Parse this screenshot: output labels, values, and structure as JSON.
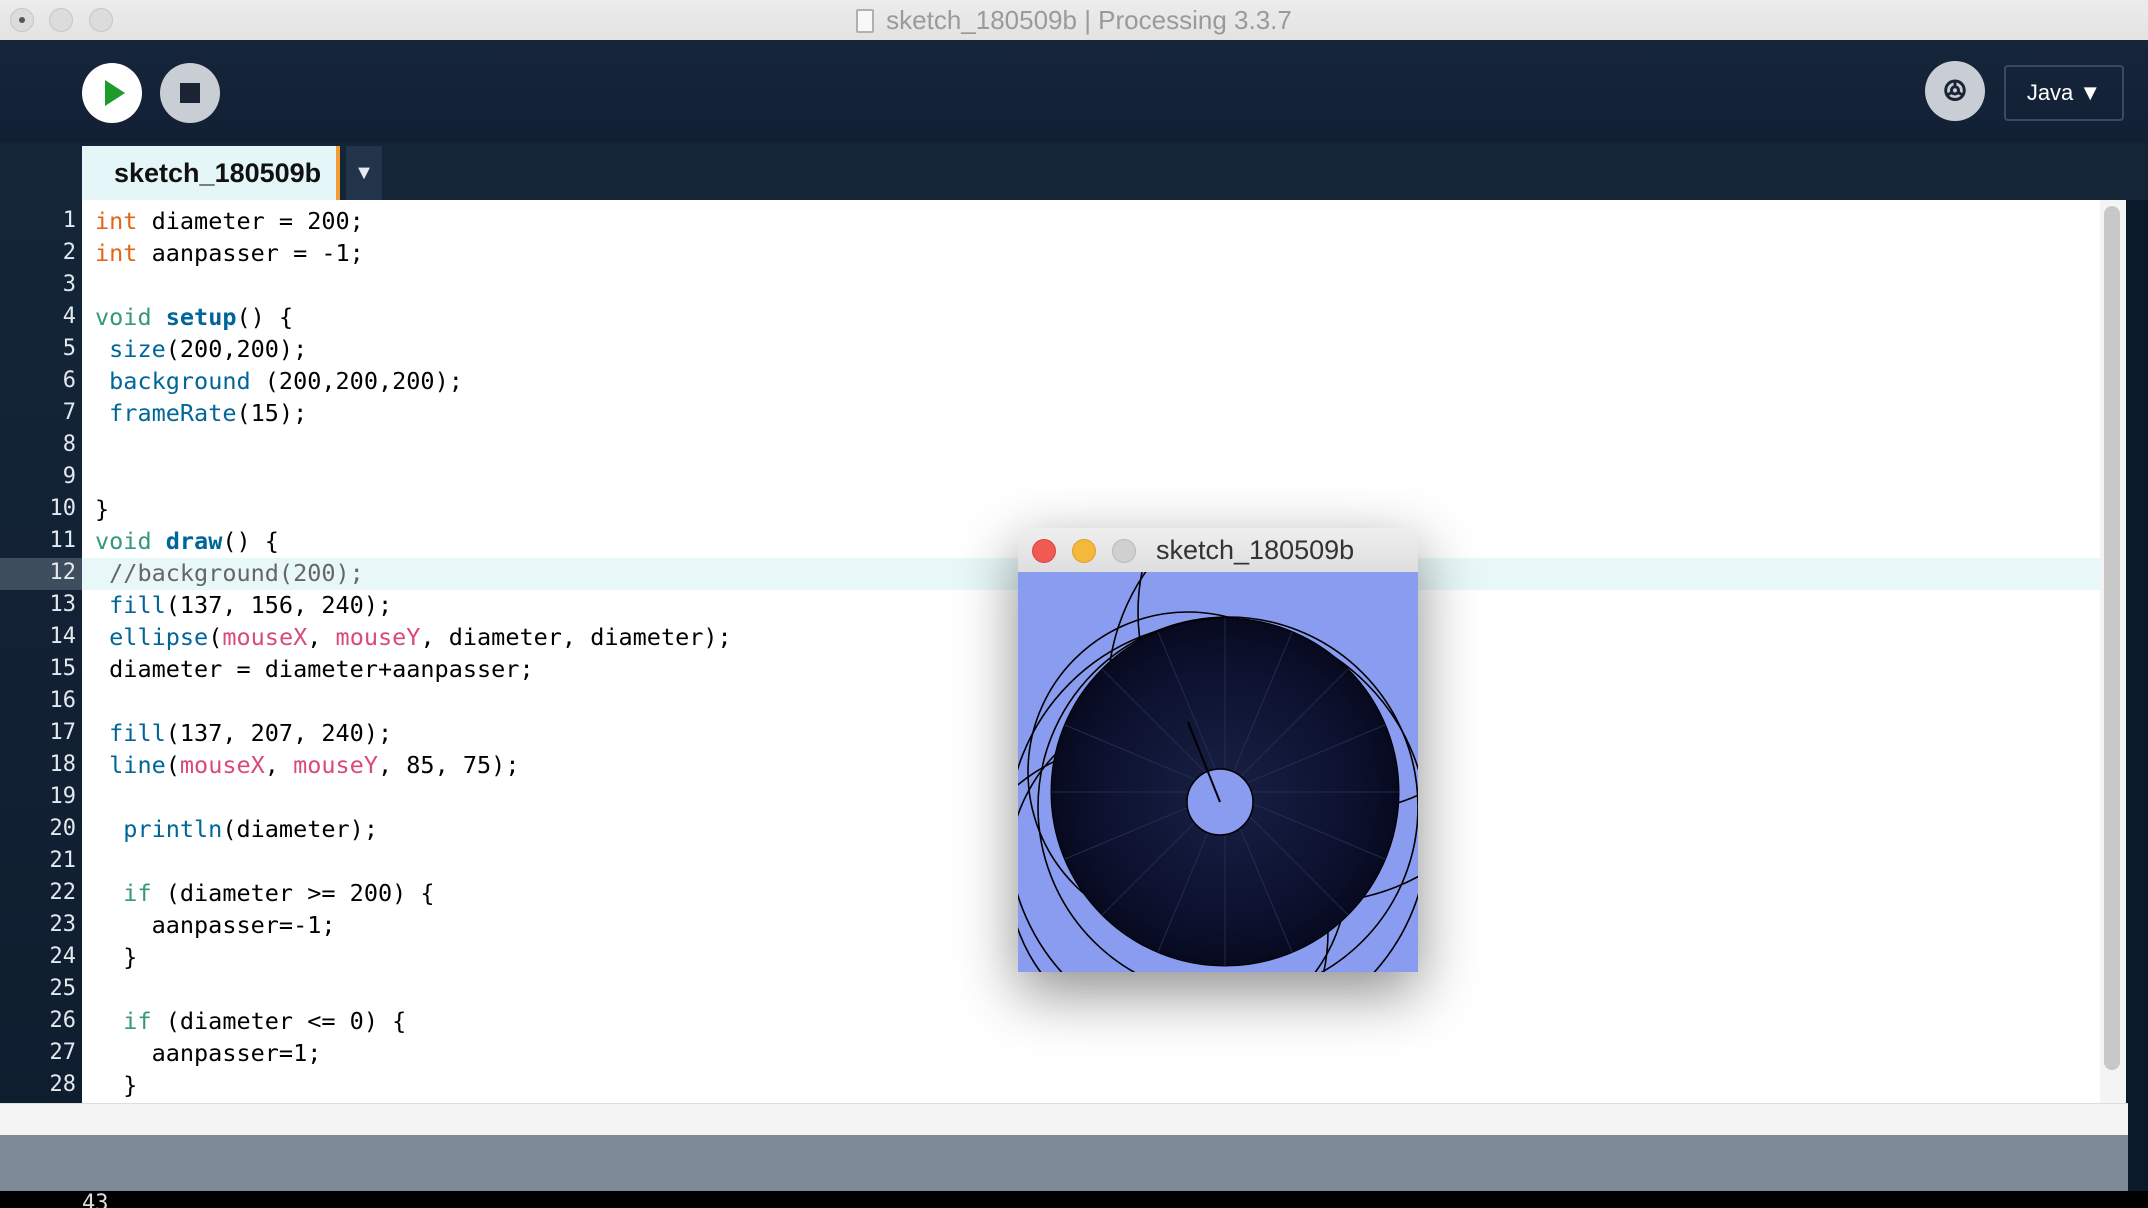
{
  "window": {
    "title": "sketch_180509b | Processing 3.3.7"
  },
  "toolbar": {
    "run_icon": "play-icon",
    "stop_icon": "stop-icon",
    "debug_icon": "debugger-icon",
    "debug_glyph": "ꔮ",
    "mode_label": "Java ▼"
  },
  "tabs": [
    {
      "label": "sketch_180509b"
    }
  ],
  "tab_menu_glyph": "▼",
  "editor": {
    "current_line": 12,
    "lines": [
      [
        [
          "int",
          "kw"
        ],
        [
          " diameter = 200;",
          ""
        ]
      ],
      [
        [
          "int",
          "kw"
        ],
        [
          " aanpasser = -1;",
          ""
        ]
      ],
      [],
      [
        [
          "void",
          "kw2"
        ],
        [
          " ",
          ""
        ],
        [
          "setup",
          "fnb"
        ],
        [
          "() {",
          ""
        ]
      ],
      [
        [
          " ",
          ""
        ],
        [
          "size",
          "fn"
        ],
        [
          "(200,200);",
          ""
        ]
      ],
      [
        [
          " ",
          ""
        ],
        [
          "background",
          "fn"
        ],
        [
          " (200,200,200);",
          ""
        ]
      ],
      [
        [
          " ",
          ""
        ],
        [
          "frameRate",
          "fn"
        ],
        [
          "(15);",
          ""
        ]
      ],
      [],
      [],
      [
        [
          "}",
          ""
        ]
      ],
      [
        [
          "void",
          "kw2"
        ],
        [
          " ",
          ""
        ],
        [
          "draw",
          "fnb"
        ],
        [
          "() {",
          ""
        ]
      ],
      [
        [
          " //background(200);",
          "cm"
        ]
      ],
      [
        [
          " ",
          ""
        ],
        [
          "fill",
          "fn"
        ],
        [
          "(137, 156, 240);",
          ""
        ]
      ],
      [
        [
          " ",
          ""
        ],
        [
          "ellipse",
          "fn"
        ],
        [
          "(",
          ""
        ],
        [
          "mouseX",
          "var"
        ],
        [
          ", ",
          ""
        ],
        [
          "mouseY",
          "var"
        ],
        [
          ", diameter, diameter);",
          ""
        ]
      ],
      [
        [
          " diameter = diameter+aanpasser;",
          ""
        ]
      ],
      [],
      [
        [
          " ",
          ""
        ],
        [
          "fill",
          "fn"
        ],
        [
          "(137, 207, 240);",
          ""
        ]
      ],
      [
        [
          " ",
          ""
        ],
        [
          "line",
          "fn"
        ],
        [
          "(",
          ""
        ],
        [
          "mouseX",
          "var"
        ],
        [
          ", ",
          ""
        ],
        [
          "mouseY",
          "var"
        ],
        [
          ", 85, 75);",
          ""
        ]
      ],
      [],
      [
        [
          "  ",
          ""
        ],
        [
          "println",
          "fn"
        ],
        [
          "(diameter);",
          ""
        ]
      ],
      [],
      [
        [
          "  ",
          ""
        ],
        [
          "if",
          "kw2"
        ],
        [
          " (diameter >= 200) {",
          ""
        ]
      ],
      [
        [
          "    aanpasser=-1;",
          ""
        ]
      ],
      [
        [
          "  }",
          ""
        ]
      ],
      [],
      [
        [
          "  ",
          ""
        ],
        [
          "if",
          "kw2"
        ],
        [
          " (diameter <= 0) {",
          ""
        ]
      ],
      [
        [
          "    aanpasser=1;",
          ""
        ]
      ],
      [
        [
          "  }",
          ""
        ]
      ]
    ]
  },
  "console": {
    "last_output": "43"
  },
  "sketch_window": {
    "title": "sketch_180509b",
    "background_color": "#8a9cf0",
    "fill_color": "#899cf0"
  },
  "colors": {
    "keyword": "#e2661a",
    "keyword2": "#33997e",
    "function": "#006699",
    "variable": "#d94a7a",
    "comment": "#666666"
  }
}
